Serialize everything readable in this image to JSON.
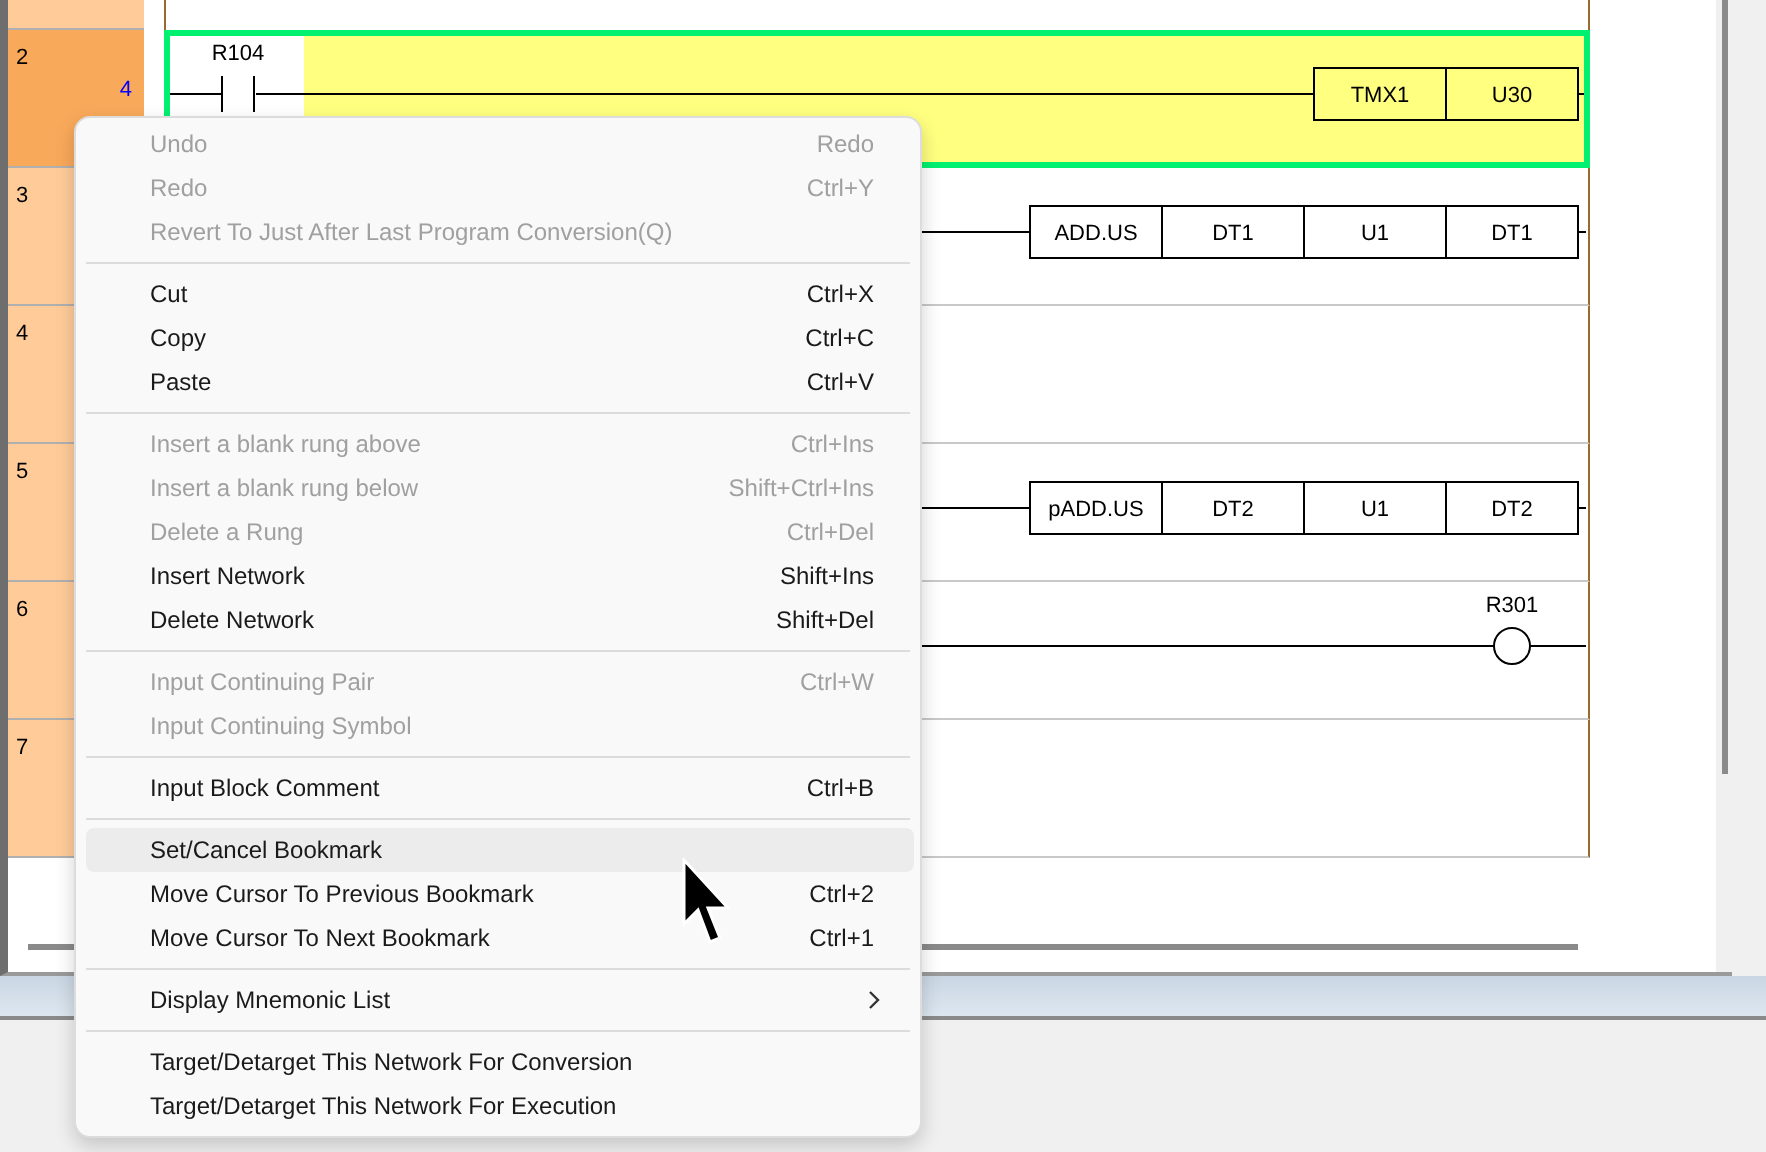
{
  "rungs": [
    {
      "number": "2",
      "step": "4",
      "selected": true,
      "elements": [
        {
          "kind": "contact",
          "label": "R104"
        },
        {
          "kind": "box",
          "cells": [
            "TMX1",
            "U30"
          ]
        }
      ]
    },
    {
      "number": "3",
      "selected": false,
      "elements": [
        {
          "kind": "box",
          "cells": [
            "ADD.US",
            "DT1",
            "U1",
            "DT1"
          ]
        }
      ]
    },
    {
      "number": "4",
      "selected": false
    },
    {
      "number": "5",
      "selected": false,
      "elements": [
        {
          "kind": "box",
          "cells": [
            "pADD.US",
            "DT2",
            "U1",
            "DT2"
          ]
        }
      ]
    },
    {
      "number": "6",
      "selected": false,
      "elements": [
        {
          "kind": "coil",
          "label": "R301"
        }
      ]
    },
    {
      "number": "7",
      "selected": false
    }
  ],
  "context_menu": {
    "items": [
      {
        "kind": "item",
        "label": "Undo",
        "shortcut": "Redo",
        "disabled": true,
        "selected": false,
        "submenu": false
      },
      {
        "kind": "item",
        "label": "Redo",
        "shortcut": "Ctrl+Y",
        "disabled": true,
        "selected": false,
        "submenu": false
      },
      {
        "kind": "item",
        "label": "Revert To Just After Last Program Conversion(Q)",
        "disabled": true,
        "selected": false,
        "submenu": false
      },
      {
        "kind": "separator"
      },
      {
        "kind": "item",
        "label": "Cut",
        "shortcut": "Ctrl+X",
        "disabled": false,
        "selected": false,
        "submenu": false
      },
      {
        "kind": "item",
        "label": "Copy",
        "shortcut": "Ctrl+C",
        "disabled": false,
        "selected": false,
        "submenu": false
      },
      {
        "kind": "item",
        "label": "Paste",
        "shortcut": "Ctrl+V",
        "disabled": false,
        "selected": false,
        "submenu": false
      },
      {
        "kind": "separator"
      },
      {
        "kind": "item",
        "label": "Insert a blank rung above",
        "shortcut": "Ctrl+Ins",
        "disabled": true,
        "selected": false,
        "submenu": false
      },
      {
        "kind": "item",
        "label": "Insert a blank rung below",
        "shortcut": "Shift+Ctrl+Ins",
        "disabled": true,
        "selected": false,
        "submenu": false
      },
      {
        "kind": "item",
        "label": "Delete a Rung",
        "shortcut": "Ctrl+Del",
        "disabled": true,
        "selected": false,
        "submenu": false
      },
      {
        "kind": "item",
        "label": "Insert Network",
        "shortcut": "Shift+Ins",
        "disabled": false,
        "selected": false,
        "submenu": false
      },
      {
        "kind": "item",
        "label": "Delete Network",
        "shortcut": "Shift+Del",
        "disabled": false,
        "selected": false,
        "submenu": false
      },
      {
        "kind": "separator"
      },
      {
        "kind": "item",
        "label": "Input Continuing Pair",
        "shortcut": "Ctrl+W",
        "disabled": true,
        "selected": false,
        "submenu": false
      },
      {
        "kind": "item",
        "label": "Input Continuing Symbol",
        "disabled": true,
        "selected": false,
        "submenu": false
      },
      {
        "kind": "separator"
      },
      {
        "kind": "item",
        "label": "Input Block Comment",
        "shortcut": "Ctrl+B",
        "disabled": false,
        "selected": false,
        "submenu": false
      },
      {
        "kind": "separator"
      },
      {
        "kind": "item",
        "label": "Set/Cancel Bookmark",
        "disabled": false,
        "selected": true,
        "submenu": false
      },
      {
        "kind": "item",
        "label": "Move Cursor To Previous Bookmark",
        "shortcut": "Ctrl+2",
        "disabled": false,
        "selected": false,
        "submenu": false
      },
      {
        "kind": "item",
        "label": "Move Cursor To Next Bookmark",
        "shortcut": "Ctrl+1",
        "disabled": false,
        "selected": false,
        "submenu": false
      },
      {
        "kind": "separator"
      },
      {
        "kind": "item",
        "label": "Display Mnemonic List",
        "disabled": false,
        "selected": false,
        "submenu": true
      },
      {
        "kind": "separator"
      },
      {
        "kind": "item",
        "label": "Target/Detarget This Network For Conversion",
        "disabled": false,
        "selected": false,
        "submenu": false
      },
      {
        "kind": "item",
        "label": "Target/Detarget This Network For Execution",
        "disabled": false,
        "selected": false,
        "submenu": false
      }
    ]
  }
}
